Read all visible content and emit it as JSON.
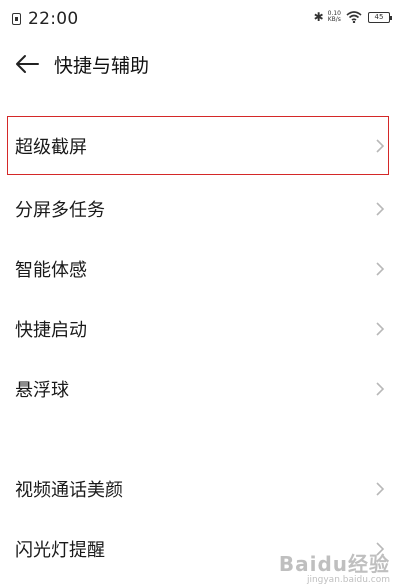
{
  "status_bar": {
    "time": "22:00",
    "bluetooth": "✱",
    "net_speed_value": "0.10",
    "net_speed_unit": "KB/s",
    "battery": "45",
    "icons": [
      "sim-icon",
      "bluetooth-icon",
      "wifi-icon",
      "battery-icon"
    ]
  },
  "header": {
    "title": "快捷与辅助",
    "back_icon": "back-arrow-icon"
  },
  "list": {
    "items": [
      {
        "label": "超级截屏",
        "highlighted": true
      },
      {
        "label": "分屏多任务"
      },
      {
        "label": "智能体感"
      },
      {
        "label": "快捷启动"
      },
      {
        "label": "悬浮球"
      },
      {
        "label": "视频通话美颜"
      },
      {
        "label": "闪光灯提醒"
      }
    ]
  },
  "watermark": {
    "main": "Baidu经验",
    "sub": "jingyan.baidu.com"
  },
  "colors": {
    "highlight_border": "#d42828",
    "chevron": "#b8b8b8",
    "text": "#1a1a1a"
  }
}
